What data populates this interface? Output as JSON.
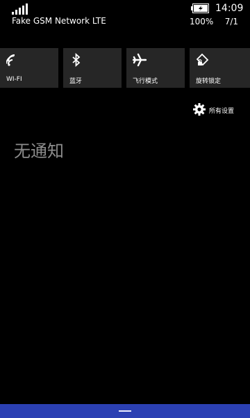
{
  "status_bar": {
    "signal_icon": "signal-strength-icon",
    "network_name": "Fake GSM Network LTE",
    "battery_icon": "battery-charging-icon",
    "time": "14:09",
    "battery_percent": "100%",
    "date": "7/1"
  },
  "quick_actions": [
    {
      "id": "wifi",
      "label": "WI-FI",
      "icon": "wifi-icon"
    },
    {
      "id": "bluetooth",
      "label": "蓝牙",
      "icon": "bluetooth-icon"
    },
    {
      "id": "airplane",
      "label": "飞行模式",
      "icon": "airplane-icon"
    },
    {
      "id": "rotation-lock",
      "label": "旋转锁定",
      "icon": "rotation-lock-icon"
    }
  ],
  "settings_link": {
    "label": "所有设置",
    "icon": "gear-icon"
  },
  "notifications": {
    "empty_text": "无通知"
  },
  "colors": {
    "background": "#000000",
    "tile": "#262626",
    "accent": "#2b40b3",
    "muted_text": "#8c8c8c"
  }
}
